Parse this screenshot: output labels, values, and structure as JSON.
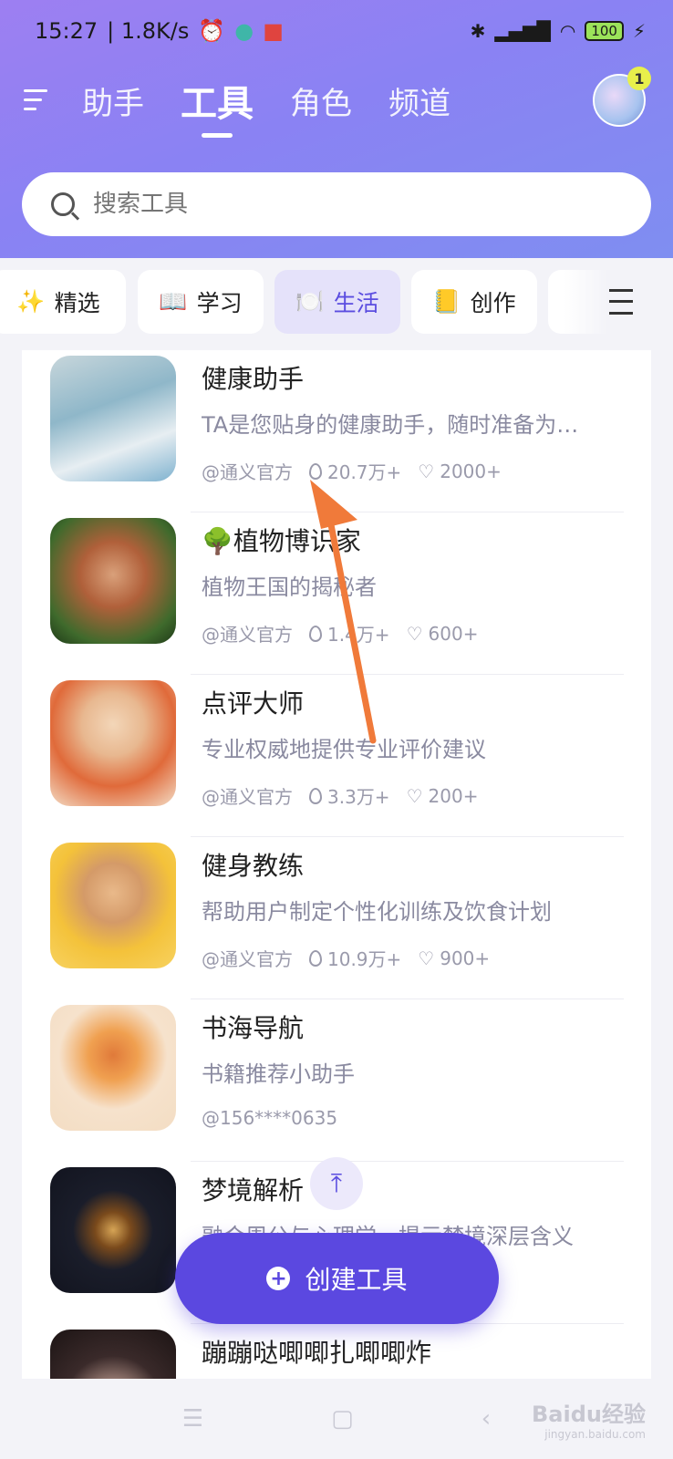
{
  "status_bar": {
    "time": "15:27",
    "speed": "| 1.8K/s",
    "battery": "100"
  },
  "nav": {
    "tabs": [
      {
        "label": "助手"
      },
      {
        "label": "工具"
      },
      {
        "label": "角色"
      },
      {
        "label": "频道"
      }
    ],
    "active_tab": "工具",
    "badge_count": "1"
  },
  "search": {
    "placeholder": "搜索工具"
  },
  "categories": [
    {
      "emoji": "✨",
      "label": "精选"
    },
    {
      "emoji": "📖",
      "label": "学习"
    },
    {
      "emoji": "🍽️",
      "label": "生活"
    },
    {
      "emoji": "📒",
      "label": "创作"
    }
  ],
  "selected_category": "生活",
  "items": [
    {
      "title": "健康助手",
      "desc": "TA是您贴身的健康助手，随时准备为…",
      "author": "@通义官方",
      "hot": "20.7万+",
      "likes": "2000+"
    },
    {
      "title": "🌳植物博识家",
      "desc": "植物王国的揭秘者",
      "author": "@通义官方",
      "hot": "1.4万+",
      "likes": "600+"
    },
    {
      "title": "点评大师",
      "desc": "专业权威地提供专业评价建议",
      "author": "@通义官方",
      "hot": "3.3万+",
      "likes": "200+"
    },
    {
      "title": "健身教练",
      "desc": "帮助用户制定个性化训练及饮食计划",
      "author": "@通义官方",
      "hot": "10.9万+",
      "likes": "900+"
    },
    {
      "title": "书海导航",
      "desc": "书籍推荐小助手",
      "author": "@156****0635"
    },
    {
      "title": "梦境解析",
      "desc": "融合周公与心理学，提示梦境深层含义",
      "author": ""
    },
    {
      "title": "蹦蹦哒唧唧扎唧唧炸",
      "desc": "",
      "author": ""
    }
  ],
  "create_button": "创建工具",
  "watermark": {
    "main": "Baidu经验",
    "sub": "jingyan.baidu.com"
  },
  "colors": {
    "accent": "#5b48e0",
    "header_gradient_start": "#9d7ff2",
    "header_gradient_end": "#7f8ef1",
    "annotation_arrow": "#f07a3a"
  }
}
